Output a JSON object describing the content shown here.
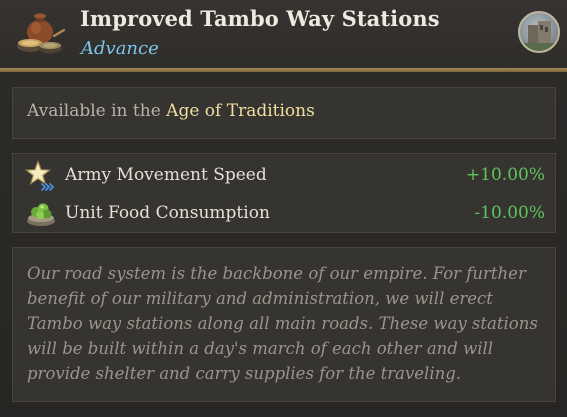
{
  "header": {
    "title": "Improved Tambo Way Stations",
    "subtitle": "Advance",
    "tech_icon": "clay-pot-and-bowls-icon",
    "era_badge_icon": "era-landscape-badge-icon"
  },
  "era": {
    "prefix": "Available in the",
    "name": "Age of Traditions"
  },
  "effects": [
    {
      "icon": "star-movement-icon",
      "label": "Army Movement Speed",
      "value": "+10.00%"
    },
    {
      "icon": "food-bowl-icon",
      "label": "Unit Food Consumption",
      "value": "-10.00%"
    }
  ],
  "description": "Our road system is the backbone of our empire. For further benefit of our military and administration, we will erect Tambo way stations along all main roads. These way stations will be built within a day's march of each other and will provide shelter and carry supplies for the traveling.",
  "colors": {
    "accent_gold": "#a88a57",
    "era_text": "#f0dfa2",
    "subtitle_blue": "#7cc4e8",
    "positive_green": "#5fc45c"
  }
}
